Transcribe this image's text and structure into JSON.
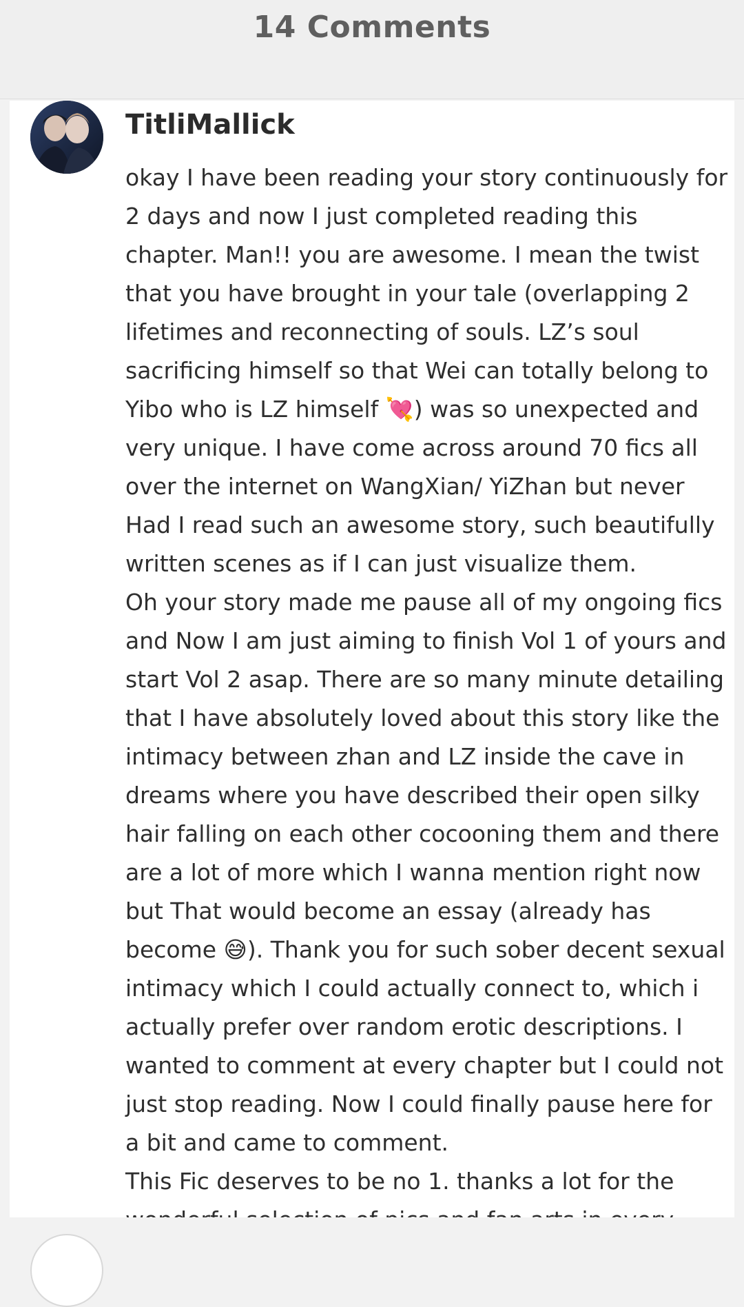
{
  "header": {
    "title": "14 Comments"
  },
  "comment": {
    "avatar_icon": "user-avatar-icon",
    "username": "TitliMallick",
    "body": "okay I have been reading your story continuously for 2 days and now I just completed reading this chapter. Man!! you are awesome. I mean the twist that you have brought in your tale (overlapping 2 lifetimes and reconnecting of souls. LZ’s soul sacrificing himself so that Wei can totally belong to Yibo who is LZ himself 💘) was so unexpected and very unique. I have come across around 70 fics all over the internet on WangXian/ YiZhan but never Had I read such an awesome story, such beautifully written scenes as if I can just visualize them.\nOh your story made me pause all of my ongoing fics and Now I am just aiming to finish Vol 1 of yours and start Vol 2 asap. There are so many minute detailing that I have absolutely loved about this story like the intimacy between zhan and LZ inside the cave in dreams where you have described their open silky hair falling on each other cocooning them and there are a lot of more which I wanna mention right now but That would become an essay (already has become 😅). Thank you for such sober decent sexual intimacy which I could actually connect to, which i actually prefer over random erotic descriptions. I wanted to comment at every chapter but I could not just stop reading. Now I could finally pause here for a bit and came to comment.\nThis Fic deserves to be no 1. thanks a lot for the wonderful selection of pics and fan arts in every"
  },
  "colors": {
    "header_bg": "#efefef",
    "header_text": "#5f5f5f",
    "card_bg": "#ffffff",
    "body_text": "#2e2e2e",
    "username_text": "#2b2b2b"
  }
}
